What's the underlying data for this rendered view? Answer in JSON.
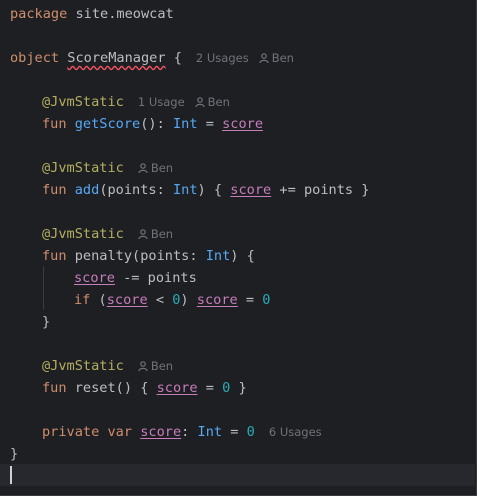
{
  "code": {
    "package_kw": "package",
    "package_name": " site.meowcat",
    "object_kw": "object",
    "object_name": "ScoreManager",
    "object_brace": " {",
    "object_usages": "2 Usages",
    "author": "Ben",
    "jvm_static": "@JvmStatic",
    "getscore_usages": "1 Usage",
    "fun_kw": "fun",
    "getscore_name": "getScore",
    "getscore_sig": "(): ",
    "int_type": "Int",
    "eq": " = ",
    "score_field": "score",
    "add_name": "add",
    "add_params_open": "(points: ",
    "add_body_open": ") { ",
    "add_body_rest": " += points }",
    "penalty_name": "penalty",
    "penalty_params_open": "(points: ",
    "penalty_sig_close": ") {",
    "penalty_line1_rest": " -= points",
    "if_kw": "if",
    "if_open": " (",
    "lt": " < ",
    "zero": "0",
    "if_close": ") ",
    "assign": " = ",
    "close_brace": "}",
    "reset_name": "reset",
    "reset_open": "() { ",
    "reset_close": " }",
    "private_kw": "private",
    "var_kw": "var",
    "colon": ": ",
    "score_usages": "6 Usages"
  },
  "colors": {
    "background": "#1e1f22",
    "keyword": "#cf8e6d",
    "annotation": "#b3ae60",
    "function": "#56a8f5",
    "number": "#2aacb8",
    "field": "#c77dbb",
    "hint": "#6f737a"
  }
}
